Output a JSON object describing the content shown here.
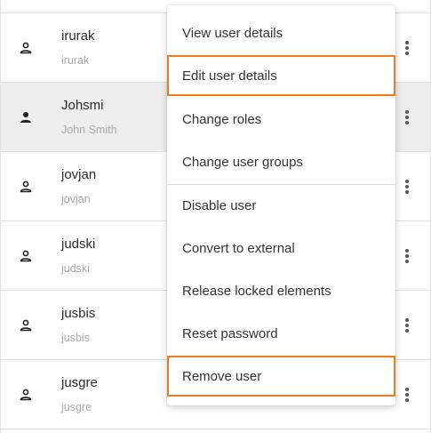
{
  "users": [
    {
      "name": "irurak",
      "login": "irurak",
      "selected": false
    },
    {
      "name": "Johsmi",
      "login": "John Smith",
      "selected": true
    },
    {
      "name": "jovjan",
      "login": "jovjan",
      "selected": false
    },
    {
      "name": "judski",
      "login": "judski",
      "selected": false
    },
    {
      "name": "jusbis",
      "login": "jusbis",
      "selected": false
    },
    {
      "name": "jusgre",
      "login": "jusgre",
      "selected": false
    }
  ],
  "menu": {
    "items": [
      {
        "label": "View user details",
        "highlighted": false
      },
      {
        "label": "Edit user details",
        "highlighted": true
      },
      {
        "label": "Change roles",
        "highlighted": false
      },
      {
        "label": "Change user groups",
        "highlighted": false
      },
      {
        "label": "Disable user",
        "highlighted": false
      },
      {
        "label": "Convert to external",
        "highlighted": false
      },
      {
        "label": "Release locked elements",
        "highlighted": false
      },
      {
        "label": "Reset password",
        "highlighted": false
      },
      {
        "label": "Remove user",
        "highlighted": false,
        "outlined": true
      }
    ]
  },
  "icons": {
    "row_icon": "person-icon",
    "row_action": "more-vertical-icon"
  },
  "colors": {
    "highlight_border": "#ee7a22",
    "selected_row": "#eeeeee"
  }
}
